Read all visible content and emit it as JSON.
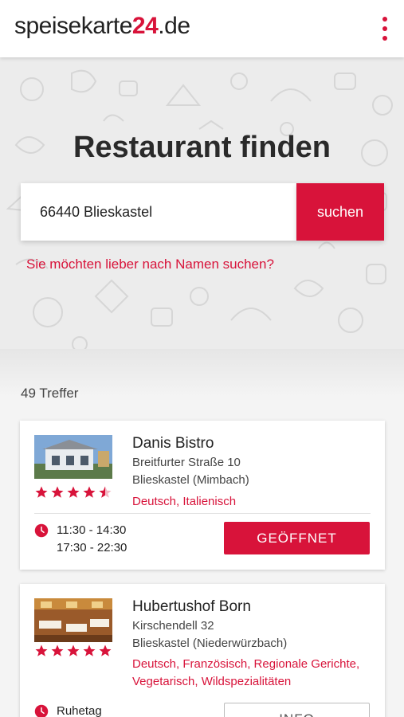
{
  "header": {
    "logo_text": "speisekarte",
    "logo_number": "24",
    "logo_tld": ".de",
    "menu_icon": "more-vertical-icon"
  },
  "hero": {
    "title": "Restaurant finden",
    "search_value": "66440 Blieskastel",
    "search_button": "suchen",
    "name_search_link": "Sie möchten lieber nach Namen suchen?"
  },
  "results": {
    "count_label": "49 Treffer",
    "items": [
      {
        "name": "Danis Bistro",
        "street": "Breitfurter Straße 10",
        "city": "Blieskastel (Mimbach)",
        "cuisine": "Deutsch, Italienisch",
        "rating": 4.5,
        "hours_line1": "11:30 - 14:30",
        "hours_line2": "17:30 - 22:30",
        "status_button": "GEÖFFNET"
      },
      {
        "name": "Hubertushof Born",
        "street": "Kirschendell 32",
        "city": "Blieskastel (Niederwürzbach)",
        "cuisine": "Deutsch, Französisch, Regionale Gerichte, Vegetarisch, Wildspezialitäten",
        "rating": 5,
        "hours_line1": "Ruhetag",
        "status_button": "INFO"
      }
    ]
  },
  "colors": {
    "accent": "#d8133a",
    "background": "#f2f2f2"
  }
}
